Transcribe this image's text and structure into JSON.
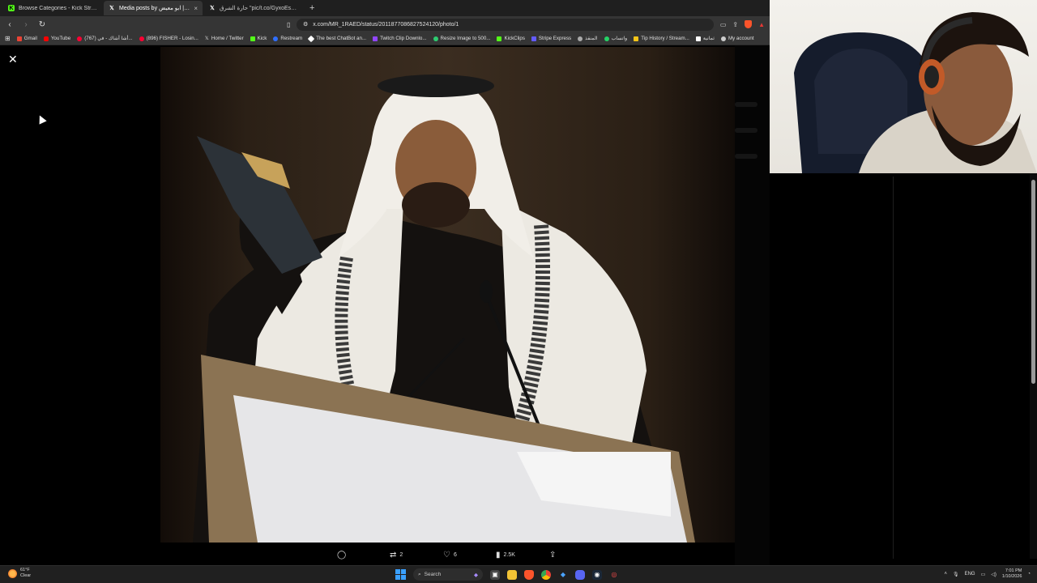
{
  "browser": {
    "tabs": [
      {
        "title": "Browse Categories - Kick Streaming",
        "icon": "kick-icon",
        "active": false
      },
      {
        "title": "Media posts by ابو معيض | RAE",
        "icon": "x-icon",
        "active": true
      },
      {
        "title": "حارة الشرق \"pic/t.co/GyxoEsRsFy\" / X",
        "icon": "x-icon",
        "active": false
      }
    ],
    "tab_close": "×",
    "new_tab": "+",
    "url": "x.com/MR_1RAED/status/2011877086827524120/photo/1",
    "bookmarks": [
      {
        "label": "Gmail",
        "color": "#ea4335"
      },
      {
        "label": "YouTube",
        "color": "#ff0000"
      },
      {
        "label": "(767) أشا أشاك - في...",
        "color": "#ff0033"
      },
      {
        "label": "(896) FISHER - Losin...",
        "color": "#ff0033"
      },
      {
        "label": "Home / Twitter",
        "color": "#ffffff"
      },
      {
        "label": "Kick",
        "color": "#53fc18"
      },
      {
        "label": "Restream",
        "color": "#2f6fff"
      },
      {
        "label": "The best ChatBot an...",
        "color": "#ffffff"
      },
      {
        "label": "Twitch Clip Downlo...",
        "color": "#9146ff"
      },
      {
        "label": "Resize Image to 500...",
        "color": "#2ecc71"
      },
      {
        "label": "KickClips",
        "color": "#53fc18"
      },
      {
        "label": "Stripe Express",
        "color": "#635bff"
      },
      {
        "label": "المنقذ",
        "color": "#aaaaaa"
      },
      {
        "label": "واتساب",
        "color": "#25d366"
      },
      {
        "label": "Tip History / Stream...",
        "color": "#f5c518"
      },
      {
        "label": "ثمانية",
        "color": "#ffffff"
      },
      {
        "label": "My account",
        "color": "#cccccc"
      }
    ]
  },
  "viewer": {
    "close_icon": "close-icon",
    "actions": {
      "reply_count": "",
      "repost_count": "2",
      "like_count": "6",
      "views_count": "2.5K"
    }
  },
  "taskbar": {
    "weather_temp": "61°F",
    "weather_desc": "Clear",
    "search_placeholder": "Search",
    "language": "ENG",
    "time": "7:01 PM",
    "date": "1/10/2026"
  }
}
